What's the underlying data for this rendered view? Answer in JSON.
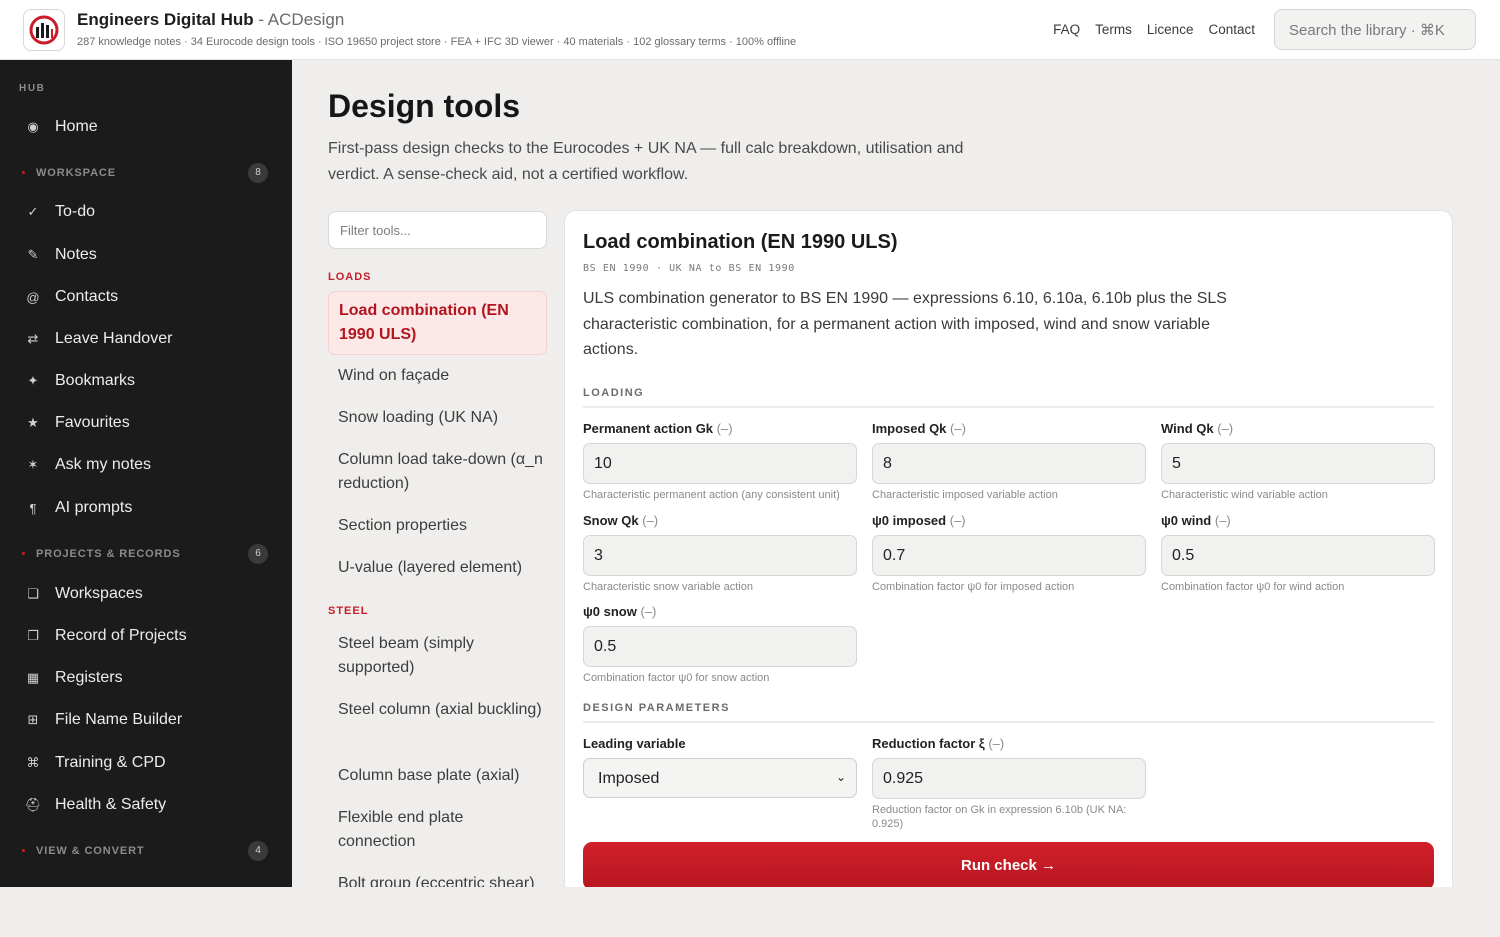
{
  "header": {
    "brand": "Engineers Digital Hub",
    "brand_sub": " - ACDesign",
    "tagline": "287 knowledge notes · 34 Eurocode design tools · ISO 19650 project store · FEA + IFC 3D viewer · 40 materials · 102 glossary terms · 100% offline",
    "nav": [
      "FAQ",
      "Terms",
      "Licence",
      "Contact"
    ],
    "search_placeholder": "Search the library · ⌘K"
  },
  "sidebar": {
    "hub_label": "HUB",
    "home": "Home",
    "workspace": {
      "label": "WORKSPACE",
      "count": "8",
      "items": [
        "To-do",
        "Notes",
        "Contacts",
        "Leave Handover",
        "Bookmarks",
        "Favourites",
        "Ask my notes",
        "AI prompts"
      ]
    },
    "projects": {
      "label": "PROJECTS & RECORDS",
      "count": "6",
      "items": [
        "Workspaces",
        "Record of Projects",
        "Registers",
        "File Name Builder",
        "Training & CPD",
        "Health & Safety"
      ]
    },
    "view": {
      "label": "VIEW & CONVERT",
      "count": "4"
    }
  },
  "main": {
    "title": "Design tools",
    "description": "First-pass design checks to the Eurocodes + UK NA — full calc breakdown, utilisation and verdict. A sense-check aid, not a certified workflow.",
    "filter_placeholder": "Filter tools...",
    "categories": {
      "loads": "LOADS",
      "steel": "STEEL"
    },
    "loads_tools": [
      "Load combination (EN 1990 ULS)",
      "Wind on façade",
      "Snow loading (UK NA)",
      "Column load take-down (α_n reduction)",
      "Section properties",
      "U-value (layered element)"
    ],
    "steel_tools": [
      "Steel beam (simply supported)",
      "Steel column (axial buckling)",
      "Column base plate (axial)",
      "Flexible end plate connection",
      "Bolt group (eccentric shear)"
    ]
  },
  "card": {
    "title": "Load combination (EN 1990 ULS)",
    "ref": "BS EN 1990 · UK NA to BS EN 1990",
    "description": "ULS combination generator to BS EN 1990 — expressions 6.10, 6.10a, 6.10b plus the SLS characteristic combination, for a permanent action with imposed, wind and snow variable actions.",
    "loading_head": "LOADING",
    "fields": {
      "gk": {
        "label": "Permanent action Gk",
        "unit": "(–)",
        "value": "10",
        "hint": "Characteristic permanent action (any consistent unit)"
      },
      "qk_imp": {
        "label": "Imposed Qk",
        "unit": "(–)",
        "value": "8",
        "hint": "Characteristic imposed variable action"
      },
      "qk_wind": {
        "label": "Wind Qk",
        "unit": "(–)",
        "value": "5",
        "hint": "Characteristic wind variable action"
      },
      "qk_snow": {
        "label": "Snow Qk",
        "unit": "(–)",
        "value": "3",
        "hint": "Characteristic snow variable action"
      },
      "psi_imp": {
        "label": "ψ0 imposed",
        "unit": "(–)",
        "value": "0.7",
        "hint": "Combination factor ψ0 for imposed action"
      },
      "psi_wind": {
        "label": "ψ0 wind",
        "unit": "(–)",
        "value": "0.5",
        "hint": "Combination factor ψ0 for wind action"
      },
      "psi_snow": {
        "label": "ψ0 snow",
        "unit": "(–)",
        "value": "0.5",
        "hint": "Combination factor ψ0 for snow action"
      }
    },
    "design_head": "DESIGN PARAMETERS",
    "leading": {
      "label": "Leading variable",
      "value": "Imposed"
    },
    "xi": {
      "label": "Reduction factor ξ",
      "unit": "(–)",
      "value": "0.925",
      "hint": "Reduction factor on Gk in expression 6.10b (UK NA: 0.925)"
    },
    "run_label": "Run check →"
  }
}
